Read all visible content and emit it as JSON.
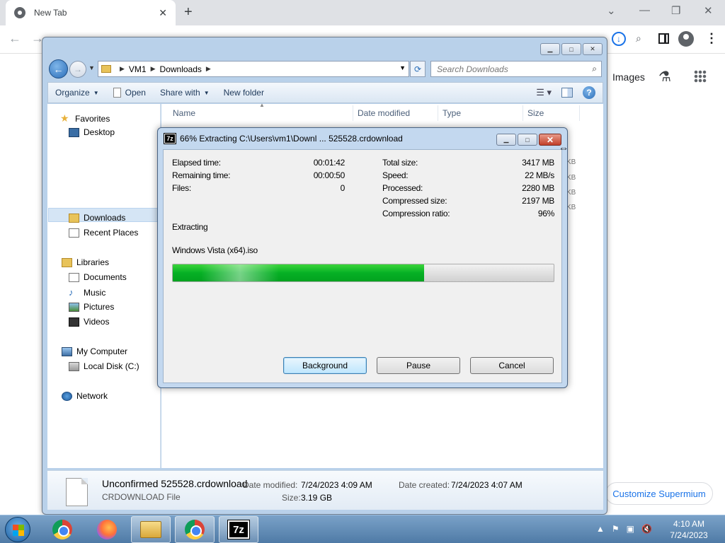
{
  "browser": {
    "tab_title": "New Tab",
    "tab_close": "✕",
    "new_tab": "+",
    "images_link": "Images",
    "customize_button": "Customize Supermium"
  },
  "explorer": {
    "breadcrumb": [
      "VM1",
      "Downloads"
    ],
    "search_placeholder": "Search Downloads",
    "commands": {
      "organize": "Organize",
      "open": "Open",
      "share_with": "Share with",
      "new_folder": "New folder"
    },
    "nav": {
      "favorites": "Favorites",
      "desktop": "Desktop",
      "downloads": "Downloads",
      "recent_places": "Recent Places",
      "libraries": "Libraries",
      "documents": "Documents",
      "music": "Music",
      "pictures": "Pictures",
      "videos": "Videos",
      "my_computer": "My Computer",
      "local_disk": "Local Disk (C:)",
      "network": "Network"
    },
    "columns": {
      "name": "Name",
      "date_modified": "Date modified",
      "type": "Type",
      "size": "Size"
    },
    "size_fragments": [
      "KB",
      "KB",
      "KB",
      "KB"
    ],
    "details": {
      "file_name": "Unconfirmed 525528.crdownload",
      "file_type": "CRDOWNLOAD File",
      "date_modified_label": "Date modified:",
      "date_modified_value": "7/24/2023 4:09 AM",
      "date_created_label": "Date created:",
      "date_created_value": "7/24/2023 4:07 AM",
      "size_label": "Size:",
      "size_value": "3.19 GB"
    }
  },
  "sevenzip": {
    "title": "66% Extracting C:\\Users\\vm1\\Downl ... 525528.crdownload",
    "app_icon_text": "7z",
    "elapsed_label": "Elapsed time:",
    "elapsed_value": "00:01:42",
    "remaining_label": "Remaining time:",
    "remaining_value": "00:00:50",
    "files_label": "Files:",
    "files_value": "0",
    "total_size_label": "Total size:",
    "total_size_value": "3417 MB",
    "speed_label": "Speed:",
    "speed_value": "22 MB/s",
    "processed_label": "Processed:",
    "processed_value": "2280 MB",
    "compressed_label": "Compressed size:",
    "compressed_value": "2197 MB",
    "ratio_label": "Compression ratio:",
    "ratio_value": "96%",
    "status_text": "Extracting",
    "current_file": "Windows Vista (x64).iso",
    "progress_percent": 66,
    "buttons": {
      "background": "Background",
      "pause": "Pause",
      "cancel": "Cancel"
    }
  },
  "taskbar": {
    "sevenzip_label": "7z",
    "clock_time": "4:10 AM",
    "clock_date": "7/24/2023"
  },
  "colors": {
    "progress_green": "#06b025",
    "chrome_accent": "#1a73e8",
    "explorer_frame": "#b9d1ea"
  }
}
